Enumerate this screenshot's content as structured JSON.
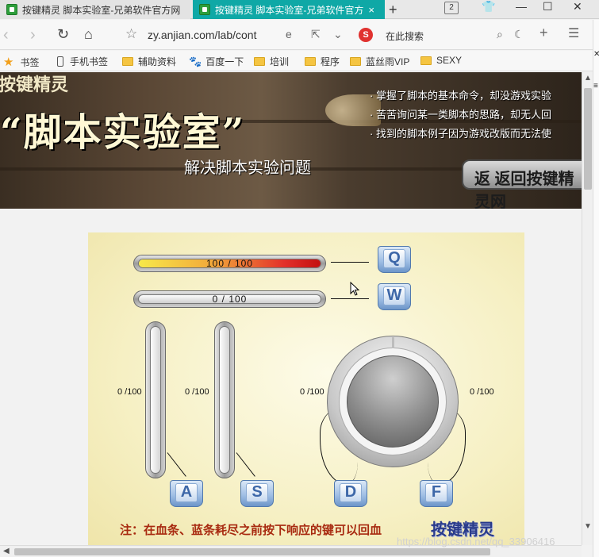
{
  "browser": {
    "tabs": [
      {
        "title": "按键精灵 脚本实验室-兄弟软件官方网",
        "close": "×"
      },
      {
        "title": "按键精灵 脚本实验室-兄弟软件官方",
        "close": "×"
      }
    ],
    "new_tab": "+",
    "tab_count": "2",
    "url": "zy.anjian.com/lab/cont",
    "search_hint": "在此搜索",
    "search_logo": "S"
  },
  "bookmarks": [
    {
      "label": "书签",
      "icon": "star-icon"
    },
    {
      "label": "手机书签",
      "icon": "phone-icon"
    },
    {
      "label": "辅助资料",
      "icon": "folder-icon"
    },
    {
      "label": "百度一下",
      "icon": "paw-icon"
    },
    {
      "label": "培训",
      "icon": "folder-icon"
    },
    {
      "label": "程序",
      "icon": "folder-icon"
    },
    {
      "label": "蓝丝雨VIP",
      "icon": "folder-icon"
    },
    {
      "label": "SEXY",
      "icon": "folder-icon"
    }
  ],
  "banner": {
    "top_title": "按键精灵",
    "title": "“脚本实验室”",
    "subtitle": "解决脚本实验问题",
    "bullets": [
      "· 掌握了脚本的基本命令，却没游戏实验",
      "· 苦苦询问某一类脚本的思路，却无人回",
      "· 找到的脚本例子因为游戏改版而无法使"
    ],
    "return_button": "返 返回按键精灵网"
  },
  "game": {
    "hp_bar": {
      "label": "100 / 100",
      "value": 100,
      "max": 100
    },
    "mp_bar": {
      "label": "0 / 100",
      "value": 0,
      "max": 100
    },
    "keys": {
      "q": "Q",
      "w": "W",
      "a": "A",
      "s": "S",
      "d": "D",
      "f": "F"
    },
    "vbar_a_label": "0 /100",
    "vbar_s_label": "0 /100",
    "knob_d_label": "0 /100",
    "knob_f_label": "0 /100",
    "note": "注：在血条、蓝条耗尽之前按下响应的键可以回血",
    "brand": "按键精灵"
  },
  "watermark": "https://blog.csdn.net/qq_33906416",
  "colors": {
    "active_tab": "#0fa8a6",
    "hp_fill": "#e3302a",
    "key_blue": "#3d67a8",
    "note_red": "#a82a10"
  }
}
